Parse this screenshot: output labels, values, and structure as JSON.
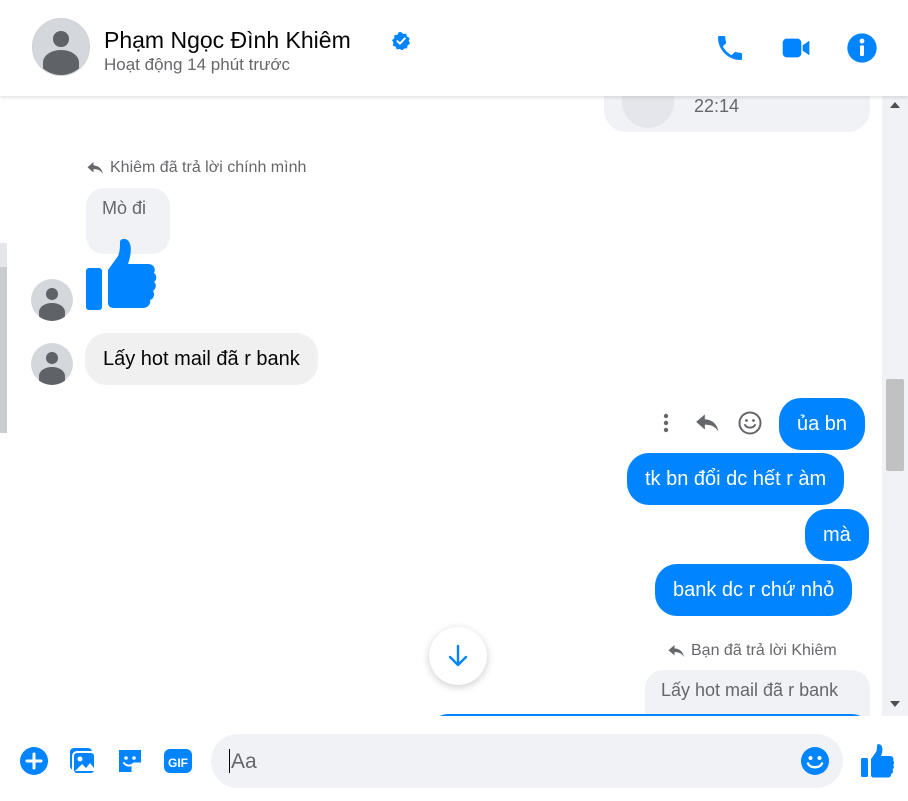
{
  "header": {
    "name": "Phạm Ngọc Đình Khiêm",
    "status": "Hoạt động 14 phút trước",
    "icons": [
      "phone-icon",
      "video-icon",
      "info-icon"
    ]
  },
  "conversation": {
    "partial_time": "22:14",
    "reply_note_1": "Khiêm đã trả lời chính mình",
    "msg_mo_di": "Mò đi",
    "msg_hotmail": "Lấy hot mail đã r bank",
    "out_msg_1": "ủa bn",
    "out_msg_2": "tk bn đổi dc hết r àm",
    "out_msg_3": "mà",
    "out_msg_4": "bank dc r chứ nhỏ",
    "reply_note_2": "Bạn đã trả lời Khiêm",
    "quoted_msg": "Lấy hot mail đã r bank"
  },
  "composer": {
    "placeholder": "Aa",
    "icons": [
      "add-icon",
      "image-icon",
      "sticker-icon",
      "gif-icon",
      "emoji-icon",
      "like-icon"
    ]
  },
  "colors": {
    "accent": "#0084ff",
    "incoming_bubble": "#f0f0f0",
    "secondary_text": "#65676b"
  }
}
